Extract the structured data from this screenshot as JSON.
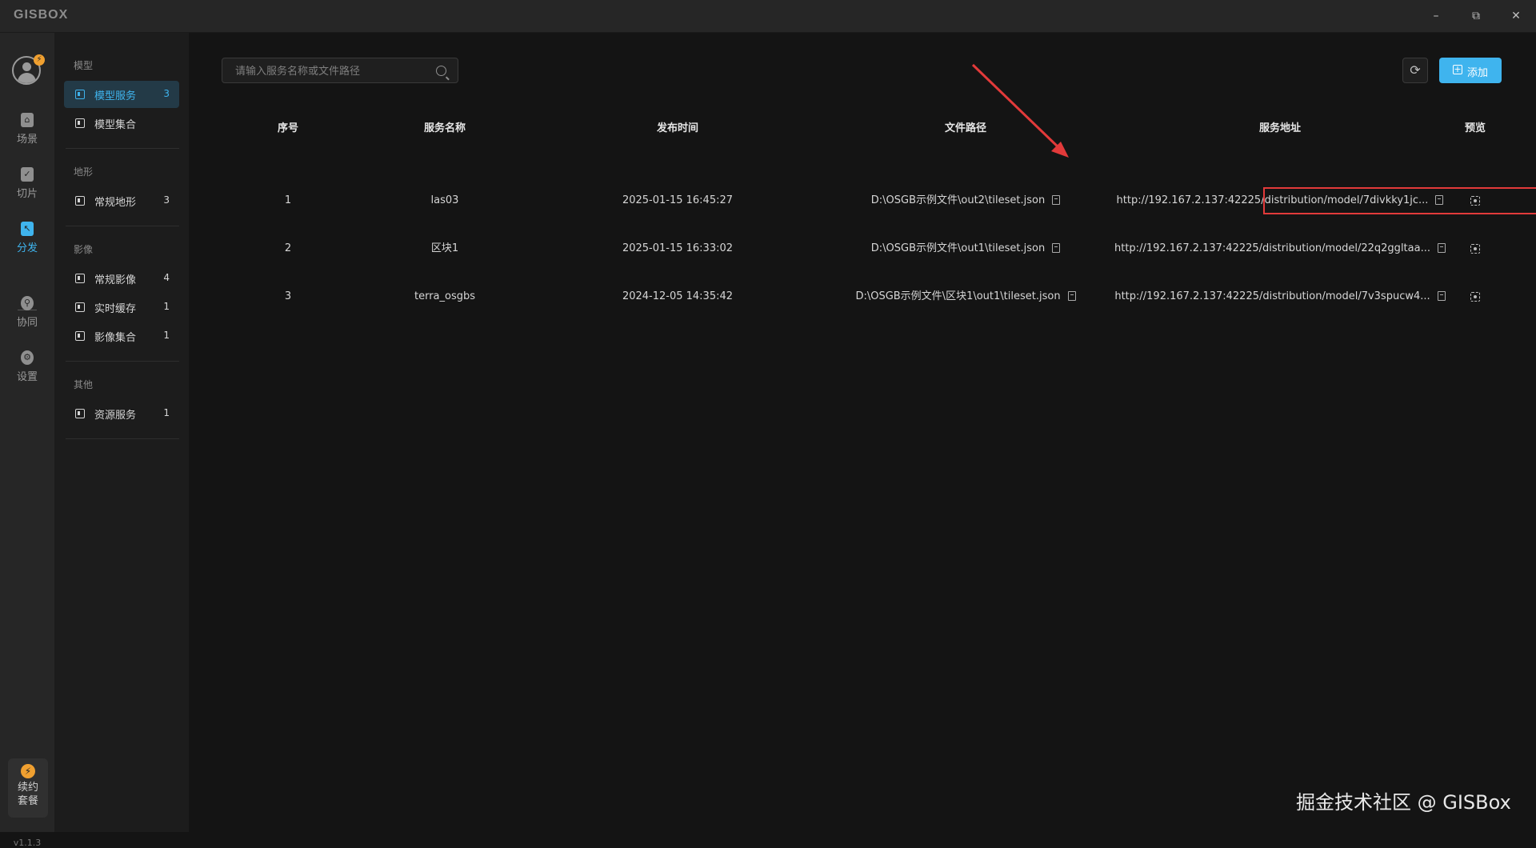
{
  "app": {
    "logo": "GISBOX",
    "window_controls": {
      "minimize": "–",
      "maximize": "⧉",
      "close": "✕"
    }
  },
  "rail": {
    "avatar_badge": "⚡",
    "items": [
      {
        "label": "场景",
        "icon": "scene-icon"
      },
      {
        "label": "切片",
        "icon": "slice-icon"
      },
      {
        "label": "分发",
        "icon": "distribute-icon"
      },
      {
        "label": "协同",
        "icon": "collab-icon"
      },
      {
        "label": "设置",
        "icon": "settings-icon"
      }
    ],
    "renew": {
      "line1": "续约",
      "line2": "套餐"
    },
    "version": "v1.1.3"
  },
  "nav": {
    "groups": [
      {
        "title": "模型",
        "items": [
          {
            "label": "模型服务",
            "count": "3"
          },
          {
            "label": "模型集合",
            "count": ""
          }
        ]
      },
      {
        "title": "地形",
        "items": [
          {
            "label": "常规地形",
            "count": "3"
          }
        ]
      },
      {
        "title": "影像",
        "items": [
          {
            "label": "常规影像",
            "count": "4"
          },
          {
            "label": "实时缓存",
            "count": "1"
          },
          {
            "label": "影像集合",
            "count": "1"
          }
        ]
      },
      {
        "title": "其他",
        "items": [
          {
            "label": "资源服务",
            "count": "1"
          }
        ]
      }
    ]
  },
  "toolbar": {
    "search_placeholder": "请输入服务名称或文件路径",
    "refresh_icon": "⟳",
    "add_label": "添加"
  },
  "table": {
    "headers": [
      "序号",
      "服务名称",
      "发布时间",
      "文件路径",
      "服务地址",
      "预览"
    ],
    "rows": [
      {
        "index": "1",
        "name": "las03",
        "time": "2025-01-15 16:45:27",
        "path": "D:\\OSGB示例文件\\out2\\tileset.json",
        "url": "http://192.167.2.137:42225/distribution/model/7divkky1jc..."
      },
      {
        "index": "2",
        "name": "区块1",
        "time": "2025-01-15 16:33:02",
        "path": "D:\\OSGB示例文件\\out1\\tileset.json",
        "url": "http://192.167.2.137:42225/distribution/model/22q2ggltaa..."
      },
      {
        "index": "3",
        "name": "terra_osgbs",
        "time": "2024-12-05 14:35:42",
        "path": "D:\\OSGB示例文件\\区块1\\out1\\tileset.json",
        "url": "http://192.167.2.137:42225/distribution/model/7v3spucw4..."
      }
    ]
  },
  "colors": {
    "accent": "#3fb4ee",
    "highlight": "#e23a3a",
    "badge": "#f0a030"
  },
  "watermark": "掘金技术社区 @ GISBox"
}
